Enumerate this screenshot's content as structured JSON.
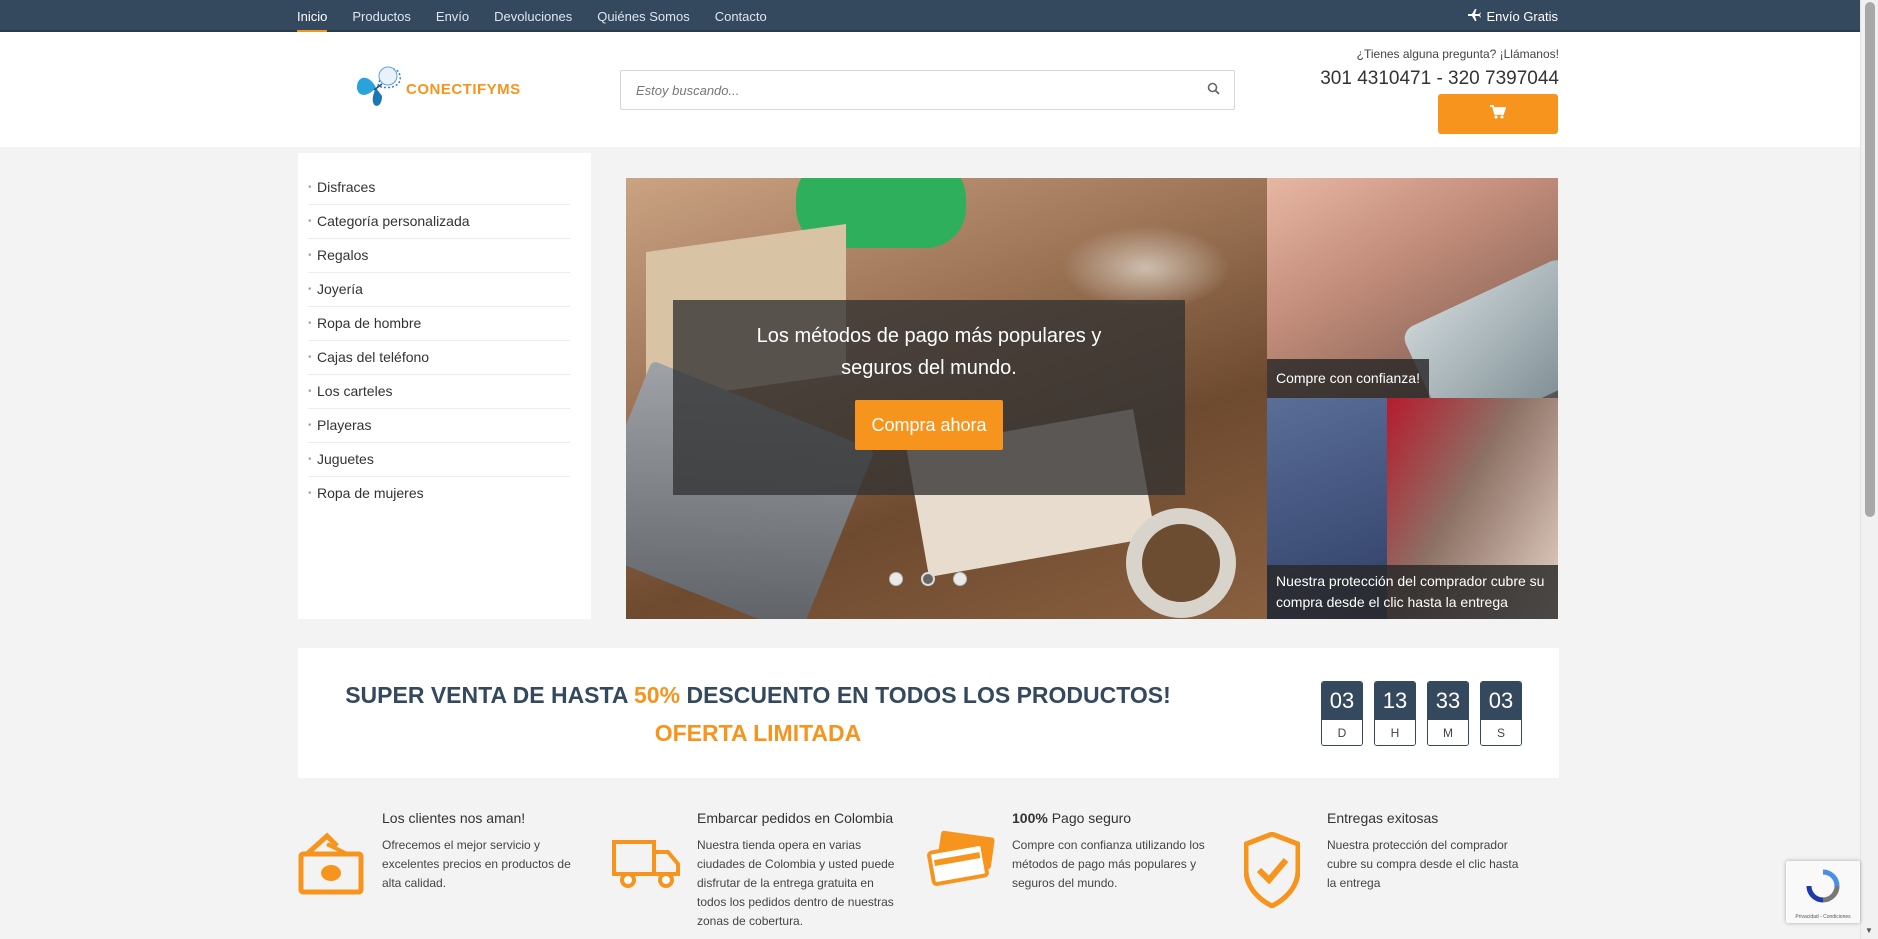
{
  "topbar": {
    "nav": [
      "Inicio",
      "Productos",
      "Envío",
      "Devoluciones",
      "Quiénes Somos",
      "Contacto"
    ],
    "free_shipping": "Envío Gratis"
  },
  "header": {
    "logo_text": "CONECTIFYMS",
    "search_placeholder": "Estoy buscando...",
    "question": "¿Tienes alguna pregunta? ¡Llámanos!",
    "phone": "301 4310471 - 320 7397044"
  },
  "sidebar": {
    "categories": [
      "Disfraces",
      "Categoría personalizada",
      "Regalos",
      "Joyería",
      "Ropa de hombre",
      "Cajas del teléfono",
      "Los carteles",
      "Playeras",
      "Juguetes",
      "Ropa de mujeres"
    ]
  },
  "slider": {
    "title": "Los métodos de pago más populares y seguros del mundo.",
    "button": "Compra ahora",
    "active_slide": 2
  },
  "promos": [
    {
      "caption": "Compre con confianza!"
    },
    {
      "caption": "Nuestra protección del comprador cubre su compra desde el clic hasta la entrega"
    }
  ],
  "sale": {
    "part1": "SUPER VENTA DE HASTA ",
    "percent": "50%",
    "part2": " DESCUENTO EN TODOS LOS PRODUCTOS! ",
    "part3": "OFERTA LIMITADA"
  },
  "countdown": [
    {
      "value": "03",
      "label": "D"
    },
    {
      "value": "13",
      "label": "H"
    },
    {
      "value": "33",
      "label": "M"
    },
    {
      "value": "03",
      "label": "S"
    }
  ],
  "features": [
    {
      "icon": "money-icon",
      "title_bold": "",
      "title": "Los clientes nos aman!",
      "text": "Ofrecemos el mejor servicio y excelentes precios en productos de alta calidad."
    },
    {
      "icon": "truck-icon",
      "title_bold": "",
      "title": "Embarcar pedidos en Colombia",
      "text": "Nuestra tienda opera en varias ciudades de Colombia y usted puede disfrutar de la entrega gratuita en todos los pedidos dentro de nuestras zonas de cobertura."
    },
    {
      "icon": "credit-card-icon",
      "title_bold": "100%",
      "title": " Pago seguro",
      "text": "Compre con confianza utilizando los métodos de pago más populares y seguros del mundo."
    },
    {
      "icon": "shield-check-icon",
      "title_bold": "",
      "title": "Entregas exitosas",
      "text": "Nuestra protección del comprador cubre su compra desde el clic hasta la entrega"
    }
  ],
  "recaptcha": {
    "text": "Privacidad - Condiciones"
  },
  "colors": {
    "accent": "#f7941e",
    "navy": "#34495e"
  }
}
